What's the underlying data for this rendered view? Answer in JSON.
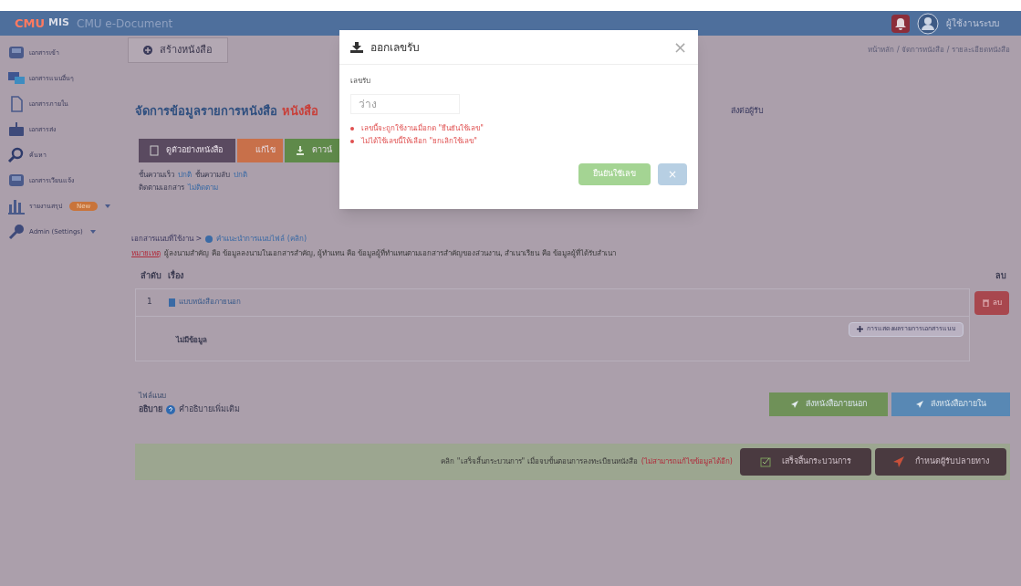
{
  "header": {
    "logo_mark": "CMU",
    "logo_mis": "MIS",
    "app_name": "CMU e-Document",
    "user_name": "ผู้ใช้งานระบบ"
  },
  "sidebar": {
    "items": [
      {
        "label": "เอกสารเข้า",
        "submenu": false
      },
      {
        "label": "เอกสารแนบอื่นๆ",
        "submenu": false
      },
      {
        "label": "เอกสารภายใน",
        "submenu": false
      },
      {
        "label": "เอกสารส่ง",
        "submenu": false
      },
      {
        "label": "ค้นหา",
        "submenu": false
      },
      {
        "label": "เอกสารเวียนแจ้ง",
        "submenu": false
      },
      {
        "label": "รายงานสรุป",
        "badge": "New",
        "submenu": true
      },
      {
        "label": "Admin (Settings)",
        "submenu": true
      }
    ]
  },
  "create_tab": "สร้างหนังสือ",
  "breadcrumb": "หน้าหลัก / จัดการหนังสือ / รายละเอียดหนังสือ",
  "page_title": {
    "text": "จัดการข้อมูลรายการหนังสือ",
    "highlight": "หนังสือ"
  },
  "actions": [
    {
      "label": "ดูตัวอย่างหนังสือ",
      "kind": "preview"
    },
    {
      "label": "แก้ไข",
      "kind": "edit"
    },
    {
      "label": "ดาวน์",
      "kind": "download"
    }
  ],
  "side_action": "ส่งต่อผู้รับ",
  "meta": [
    {
      "parts": [
        {
          "label": "ชั้นความเร็ว",
          "value": "ปกติ"
        },
        {
          "label": "ชั้นความลับ",
          "value": "ปกติ"
        }
      ]
    },
    {
      "parts": [
        {
          "label": "ติดตามเอกสาร",
          "value": "ไม่ติดตาม"
        }
      ]
    }
  ],
  "attachments": {
    "heading": "เอกสารแนบที่ใช้งาน >",
    "help_link": "คำแนะนำการแนบไฟล์ (คลิก)",
    "note_label": "หมายเหตุ",
    "note": "ผู้ลงนามสำคัญ คือ ข้อมูลลงนามในเอกสารสำคัญ, ผู้ทำแทน คือ ข้อมูลผู้ที่ทำแทนตามเอกสารสำคัญของส่วนงาน, สำเนาเรียน คือ ข้อมูลผู้ที่ได้รับสำเนา",
    "columns": [
      "ลำดับ",
      "เรื่อง",
      "ลบ"
    ],
    "rows": [
      {
        "index": "1",
        "title": "แบบหนังสือภายนอก",
        "delete": "ลบ"
      }
    ],
    "add_button": "การแสดงผลรายการเอกสารแนบ",
    "empty": "ไม่มีข้อมูล"
  },
  "file_section": {
    "label": "ไฟล์แนบ",
    "desc_label": "อธิบาย",
    "desc_text": "คำอธิบายเพิ่มเติม"
  },
  "send_buttons": [
    {
      "label": "ส่งหนังสือภายนอก",
      "kind": "green"
    },
    {
      "label": "ส่งหนังสือภายใน",
      "kind": "blue"
    }
  ],
  "finish_bar": {
    "text": "คลิก \"เสร็จสิ้นกระบวนการ\" เมื่อจบขั้นตอนการลงทะเบียนหนังสือ",
    "warning": "(ไม่สามารถแก้ไขข้อมูลได้อีก)",
    "buttons": [
      {
        "label": "เสร็จสิ้นกระบวนการ",
        "kind": "finish"
      },
      {
        "label": "กำหนดผู้รับปลายทาง",
        "kind": "send"
      }
    ]
  },
  "modal": {
    "title": "ออกเลขรับ",
    "field_label": "เลขรับ",
    "placeholder": "ว่าง",
    "notes": [
      "เลขนี้จะถูกใช้งานเมื่อกด \"ยืนยันใช้เลข\"",
      "ไม่ได้ใช้เลขนี้ให้เลือก \"ยกเลิกใช้เลข\""
    ],
    "confirm": "ยืนยันใช้เลข",
    "cancel": "×",
    "close": "×"
  }
}
